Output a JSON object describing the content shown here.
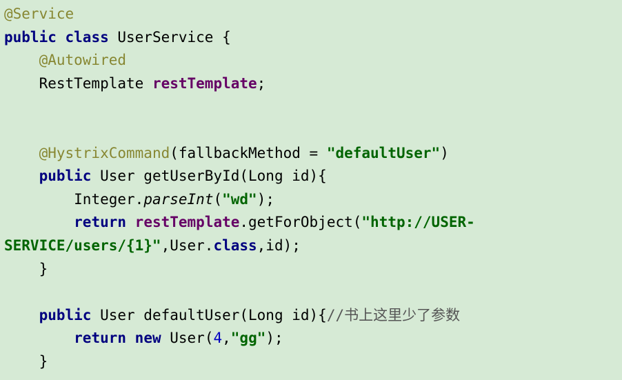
{
  "code": {
    "l1_annotation": "@Service",
    "l2_kw1": "public",
    "l2_kw2": "class",
    "l2_rest": " UserService {",
    "l3_indent": "    ",
    "l3_annotation": "@Autowired",
    "l4_indent": "    ",
    "l4_text1": "RestTemplate ",
    "l4_field": "restTemplate",
    "l4_text2": ";",
    "l7_indent": "    ",
    "l7_annotation": "@HystrixCommand",
    "l7_text1": "(fallbackMethod = ",
    "l7_string": "\"defaultUser\"",
    "l7_text2": ")",
    "l8_indent": "    ",
    "l8_kw": "public",
    "l8_text": " User getUserById(Long id){",
    "l9_indent": "        ",
    "l9_text1": "Integer.",
    "l9_italic": "parseInt",
    "l9_text2": "(",
    "l9_string": "\"wd\"",
    "l9_text3": ");",
    "l10_indent": "        ",
    "l10_kw1": "return",
    "l10_sp": " ",
    "l10_field": "restTemplate",
    "l10_text1": ".getForObject(",
    "l10_string": "\"http://USER-SERVICE/users/{1}\"",
    "l10_text2": ",User.",
    "l10_kw2": "class",
    "l10_text3": ",id);",
    "l11_indent": "    ",
    "l11_text": "}",
    "l13_indent": "    ",
    "l13_kw": "public",
    "l13_text1": " User defaultUser(Long id){",
    "l13_comment": "//书上这里少了参数",
    "l14_indent": "        ",
    "l14_kw1": "return",
    "l14_sp": " ",
    "l14_kw2": "new",
    "l14_text1": " User(",
    "l14_num": "4",
    "l14_text2": ",",
    "l14_string": "\"gg\"",
    "l14_text3": ");",
    "l15_indent": "    ",
    "l15_text": "}"
  }
}
